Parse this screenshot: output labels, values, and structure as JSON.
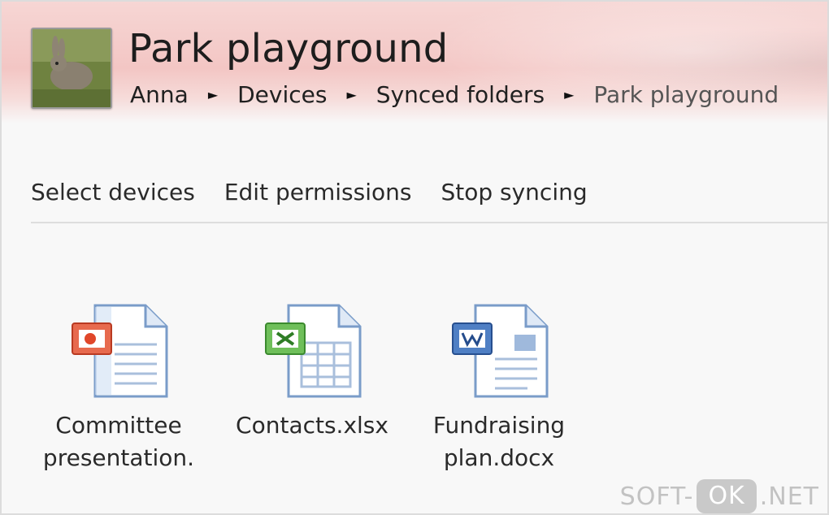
{
  "header": {
    "title": "Park playground",
    "breadcrumb": [
      "Anna",
      "Devices",
      "Synced folders",
      "Park playground"
    ],
    "separator": "►"
  },
  "toolbar": {
    "select_devices": "Select devices",
    "edit_permissions": "Edit permissions",
    "stop_syncing": "Stop syncing"
  },
  "files": [
    {
      "line1": "Committee",
      "line2": "presentation.",
      "icon": "powerpoint-file-icon",
      "accent": "#d9452b"
    },
    {
      "line1": "Contacts.xlsx",
      "line2": "",
      "icon": "excel-file-icon",
      "accent": "#3f9a3a"
    },
    {
      "line1": "Fundraising",
      "line2": "plan.docx",
      "icon": "word-file-icon",
      "accent": "#2e5fa8"
    }
  ],
  "watermark": {
    "left": "SOFT-",
    "ok": "OK",
    "right": ".NET"
  }
}
